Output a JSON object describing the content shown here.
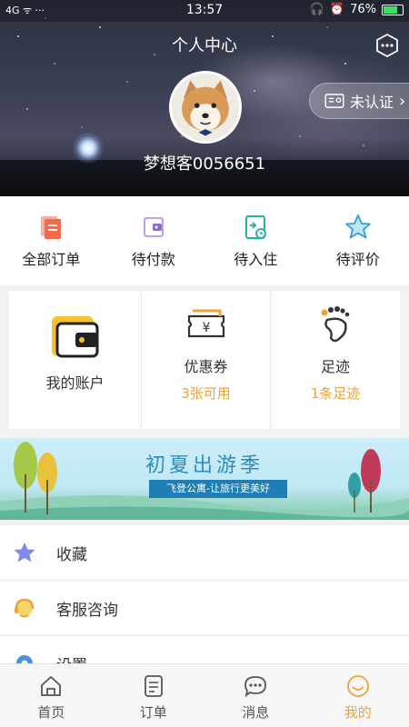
{
  "status_bar": {
    "left": "4G ᯤ ···",
    "time": "13:57",
    "battery": "76%",
    "battery_level": 0.76
  },
  "header": {
    "title": "个人中心",
    "username": "梦想客0056651",
    "verify_label": "未认证"
  },
  "orders": [
    {
      "label": "全部订单",
      "icon": "document-icon",
      "color": "#f36a4a"
    },
    {
      "label": "待付款",
      "icon": "wallet-icon",
      "color": "#8b6bd8"
    },
    {
      "label": "待入住",
      "icon": "checkin-icon",
      "color": "#29b3a8"
    },
    {
      "label": "待评价",
      "icon": "star-outline-icon",
      "color": "#2f9fd8"
    }
  ],
  "account": {
    "my_account": "我的账户",
    "coupons_label": "优惠券",
    "coupons_value": "3张可用",
    "footprint_label": "足迹",
    "footprint_value": "1条足迹"
  },
  "banner": {
    "title": "初夏出游季",
    "tagline": "飞登公寓-让旅行更美好"
  },
  "list": [
    {
      "label": "收藏",
      "icon": "star-icon"
    },
    {
      "label": "客服咨询",
      "icon": "headset-icon"
    },
    {
      "label": "设置",
      "icon": "settings-icon"
    }
  ],
  "tabbar": [
    {
      "label": "首页",
      "icon": "home-icon"
    },
    {
      "label": "订单",
      "icon": "order-icon"
    },
    {
      "label": "消息",
      "icon": "message-icon"
    },
    {
      "label": "我的",
      "icon": "smile-icon",
      "active": true
    }
  ],
  "colors": {
    "accent": "#f0a13a"
  }
}
